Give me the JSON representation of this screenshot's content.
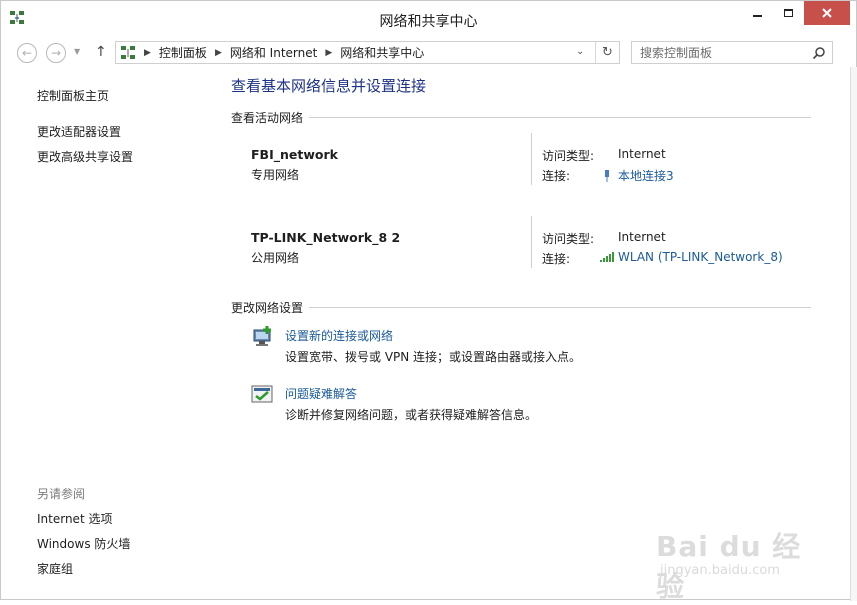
{
  "window": {
    "title": "网络和共享中心"
  },
  "navbar": {
    "breadcrumbs": [
      "控制面板",
      "网络和 Internet",
      "网络和共享中心"
    ],
    "search_placeholder": "搜索控制面板"
  },
  "left_pane": {
    "home_link": "控制面板主页",
    "links": [
      "更改适配器设置",
      "更改高级共享设置"
    ],
    "see_also_header": "另请参阅",
    "see_also": [
      "Internet 选项",
      "Windows 防火墙",
      "家庭组"
    ]
  },
  "main": {
    "title": "查看基本网络信息并设置连接",
    "active_networks_header": "查看活动网络",
    "networks": [
      {
        "name": "FBI_network",
        "category": "专用网络",
        "access_label": "访问类型:",
        "access_value": "Internet",
        "connection_label": "连接:",
        "connection_value": "本地连接3",
        "connection_icon": "ethernet-icon"
      },
      {
        "name": "TP-LINK_Network_8  2",
        "category": "公用网络",
        "access_label": "访问类型:",
        "access_value": "Internet",
        "connection_label": "连接:",
        "connection_value": "WLAN (TP-LINK_Network_8)",
        "connection_icon": "wifi-signal-icon"
      }
    ],
    "change_settings_header": "更改网络设置",
    "tasks": [
      {
        "link": "设置新的连接或网络",
        "description": "设置宽带、拨号或 VPN 连接；或设置路由器或接入点。",
        "icon": "new-connection-icon"
      },
      {
        "link": "问题疑难解答",
        "description": "诊断并修复网络问题，或者获得疑难解答信息。",
        "icon": "troubleshoot-icon"
      }
    ]
  },
  "watermark": {
    "brand": "Bai du 经验",
    "url": "jingyan.baidu.com"
  },
  "colors": {
    "title_blue": "#1e3287",
    "link_blue": "#1a5a9a",
    "close_red": "#c7504a"
  }
}
